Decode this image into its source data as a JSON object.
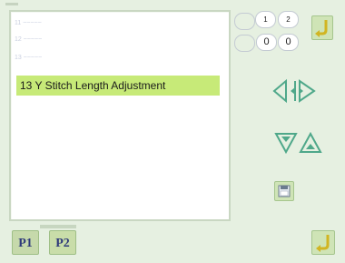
{
  "list": {
    "items": [
      {
        "label": "11 ~~~~~"
      },
      {
        "label": "12 ~~~~~"
      },
      {
        "label": "13 ~~~~~"
      }
    ],
    "selected_label": "13 Y Stitch Length Adjustment"
  },
  "counters": {
    "top_labels": [
      "1",
      "2"
    ],
    "values": [
      "0",
      "0"
    ]
  },
  "pages": {
    "p1": "P1",
    "p2": "P2"
  },
  "icons": {
    "back_top": "return-arrow-icon",
    "left_right": "left-right-arrows-icon",
    "up_down": "down-up-arrows-icon",
    "save": "save-disk-icon",
    "enter": "enter-arrow-icon"
  },
  "colors": {
    "selected_bg": "#c7ea78",
    "button_bg": "#cfe4b6",
    "arrow": "#4fa88a",
    "page_text": "#2f3a7a"
  }
}
